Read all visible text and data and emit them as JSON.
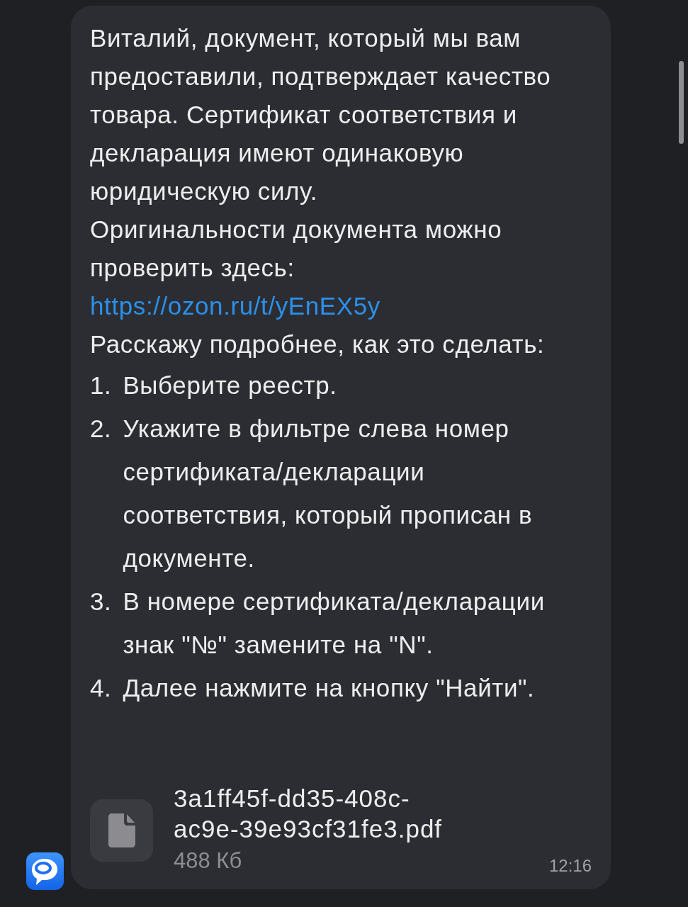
{
  "message": {
    "paragraphs": [
      {
        "text": "Виталий, документ, который мы вам предоставили, подтверждает качество товара. Сертификат соответствия и декларация имеют одинаковую юридическую силу."
      },
      {
        "text": "Оригинальности документа можно проверить здесь:",
        "link": "https://ozon.ru/t/yEnEX5y"
      },
      {
        "text": "Расскажу подробнее, как это сделать:"
      }
    ],
    "steps": [
      {
        "number": "1.",
        "text": "Выберите реестр."
      },
      {
        "number": "2.",
        "text": "Укажите в фильтре слева номер сертификата/декларации соответствия, который прописан в документе."
      },
      {
        "number": "3.",
        "text": "В номере сертификата/декларации знак \"№\" замените на \"N\"."
      },
      {
        "number": "4.",
        "text": "Далее нажмите на кнопку \"Найти\"."
      }
    ],
    "attachment": {
      "file_name": "3a1ff45f-dd35-408c-ac9e-39e93cf31fe3.pdf",
      "size": "488 Кб"
    },
    "time": "12:16"
  }
}
